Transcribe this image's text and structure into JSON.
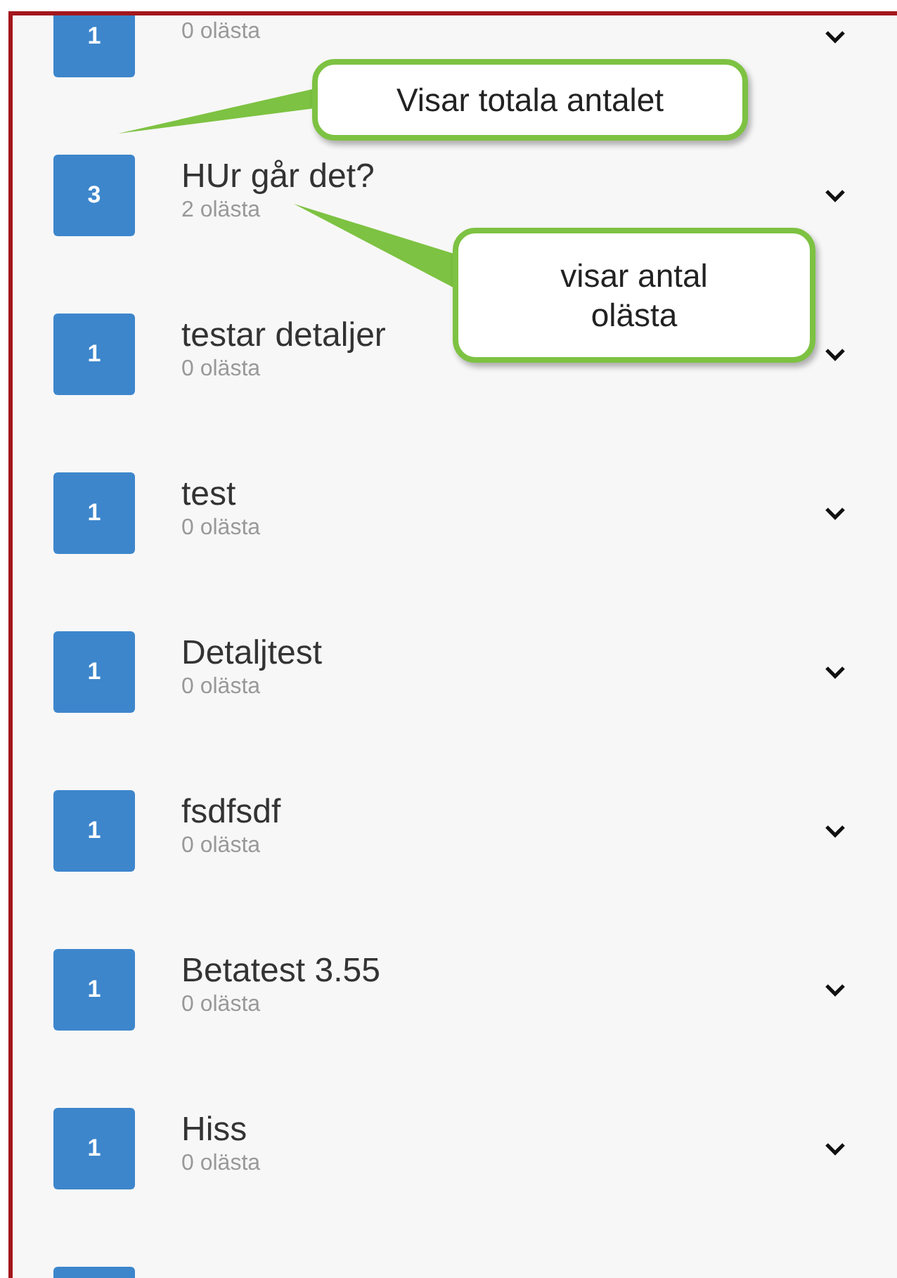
{
  "rows": [
    {
      "count": "1",
      "unread": "0 olästa"
    },
    {
      "count": "3",
      "title": "HUr går det?",
      "unread": "2 olästa"
    },
    {
      "count": "1",
      "title": "testar detaljer",
      "unread": "0 olästa"
    },
    {
      "count": "1",
      "title": "test",
      "unread": "0 olästa"
    },
    {
      "count": "1",
      "title": "Detaljtest",
      "unread": "0 olästa"
    },
    {
      "count": "1",
      "title": "fsdfsdf",
      "unread": "0 olästa"
    },
    {
      "count": "1",
      "title": "Betatest 3.55",
      "unread": "0 olästa"
    },
    {
      "count": "1",
      "title": "Hiss",
      "unread": "0 olästa"
    },
    {}
  ],
  "callouts": [
    {
      "text": "Visar totala antalet"
    },
    {
      "text": "visar antal olästa"
    }
  ]
}
